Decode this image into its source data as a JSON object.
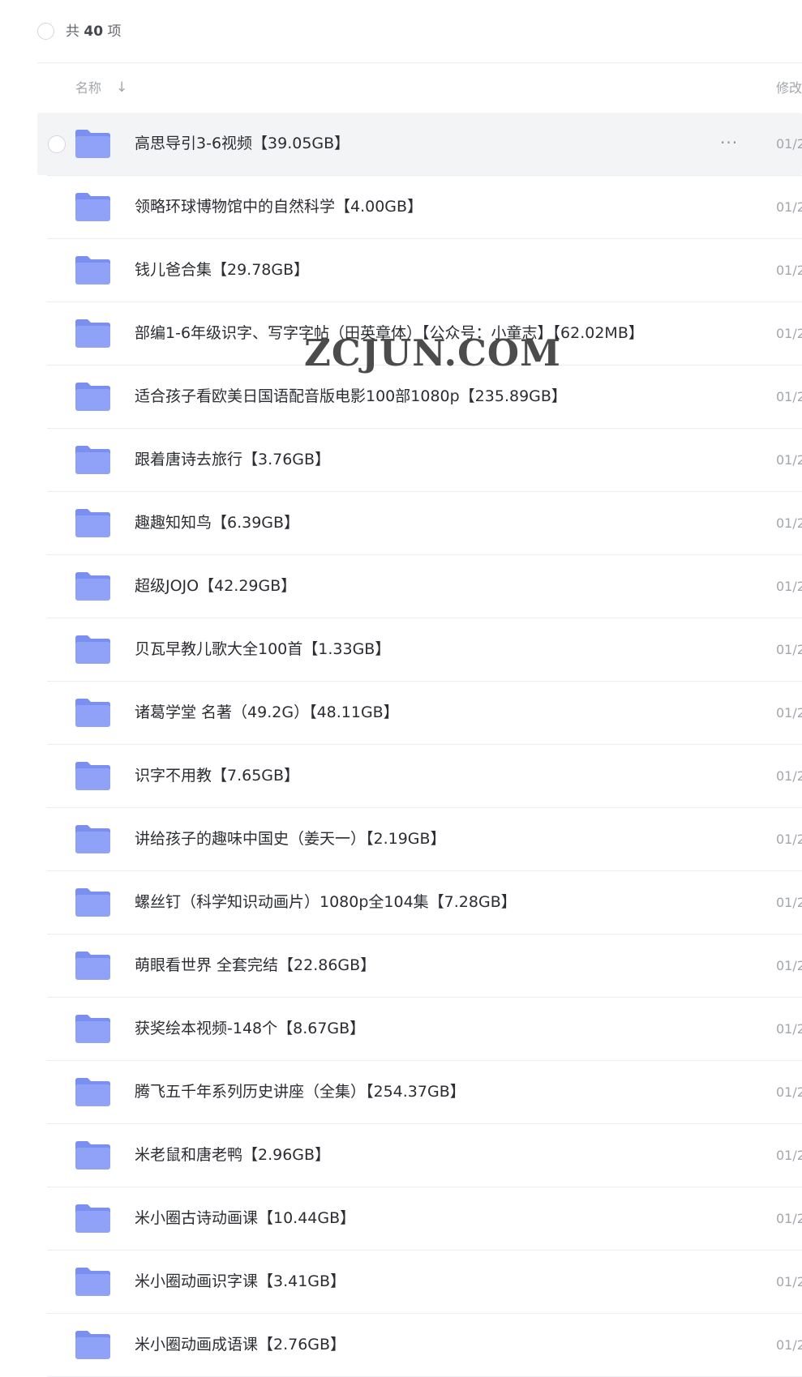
{
  "toolbar": {
    "count_prefix": "共",
    "count_value": "40",
    "count_suffix": "项"
  },
  "header": {
    "name_label": "名称",
    "sort_arrow": "↓",
    "modified_label": "修改"
  },
  "row_actions": {
    "more_label": "···"
  },
  "icons": {
    "folder": "folder-icon",
    "folder_color": "#8fa2f7",
    "folder_color_dark": "#7a8ff0"
  },
  "files": [
    {
      "name": "高思导引3-6视频【39.05GB】",
      "date": "01/2"
    },
    {
      "name": "领略环球博物馆中的自然科学【4.00GB】",
      "date": "01/2"
    },
    {
      "name": "钱儿爸合集【29.78GB】",
      "date": "01/2"
    },
    {
      "name": "部编1-6年级识字、写字字帖（田英章体）【公众号：小童志】【62.02MB】",
      "date": "01/2"
    },
    {
      "name": "适合孩子看欧美日国语配音版电影100部1080p【235.89GB】",
      "date": "01/2"
    },
    {
      "name": "跟着唐诗去旅行【3.76GB】",
      "date": "01/2"
    },
    {
      "name": "趣趣知知鸟【6.39GB】",
      "date": "01/2"
    },
    {
      "name": "超级JOJO【42.29GB】",
      "date": "01/2"
    },
    {
      "name": "贝瓦早教儿歌大全100首【1.33GB】",
      "date": "01/2"
    },
    {
      "name": "诸葛学堂 名著（49.2G）【48.11GB】",
      "date": "01/2"
    },
    {
      "name": "识字不用教【7.65GB】",
      "date": "01/2"
    },
    {
      "name": "讲给孩子的趣味中国史（姜天一）【2.19GB】",
      "date": "01/2"
    },
    {
      "name": "螺丝钉（科学知识动画片）1080p全104集【7.28GB】",
      "date": "01/2"
    },
    {
      "name": "萌眼看世界 全套完结【22.86GB】",
      "date": "01/2"
    },
    {
      "name": "获奖绘本视频-148个【8.67GB】",
      "date": "01/2"
    },
    {
      "name": "腾飞五千年系列历史讲座（全集）【254.37GB】",
      "date": "01/2"
    },
    {
      "name": "米老鼠和唐老鸭【2.96GB】",
      "date": "01/2"
    },
    {
      "name": "米小圈古诗动画课【10.44GB】",
      "date": "01/2"
    },
    {
      "name": "米小圈动画识字课【3.41GB】",
      "date": "01/2"
    },
    {
      "name": "米小圈动画成语课【2.76GB】",
      "date": "01/2"
    }
  ],
  "watermark": "ZCJUN.COM"
}
